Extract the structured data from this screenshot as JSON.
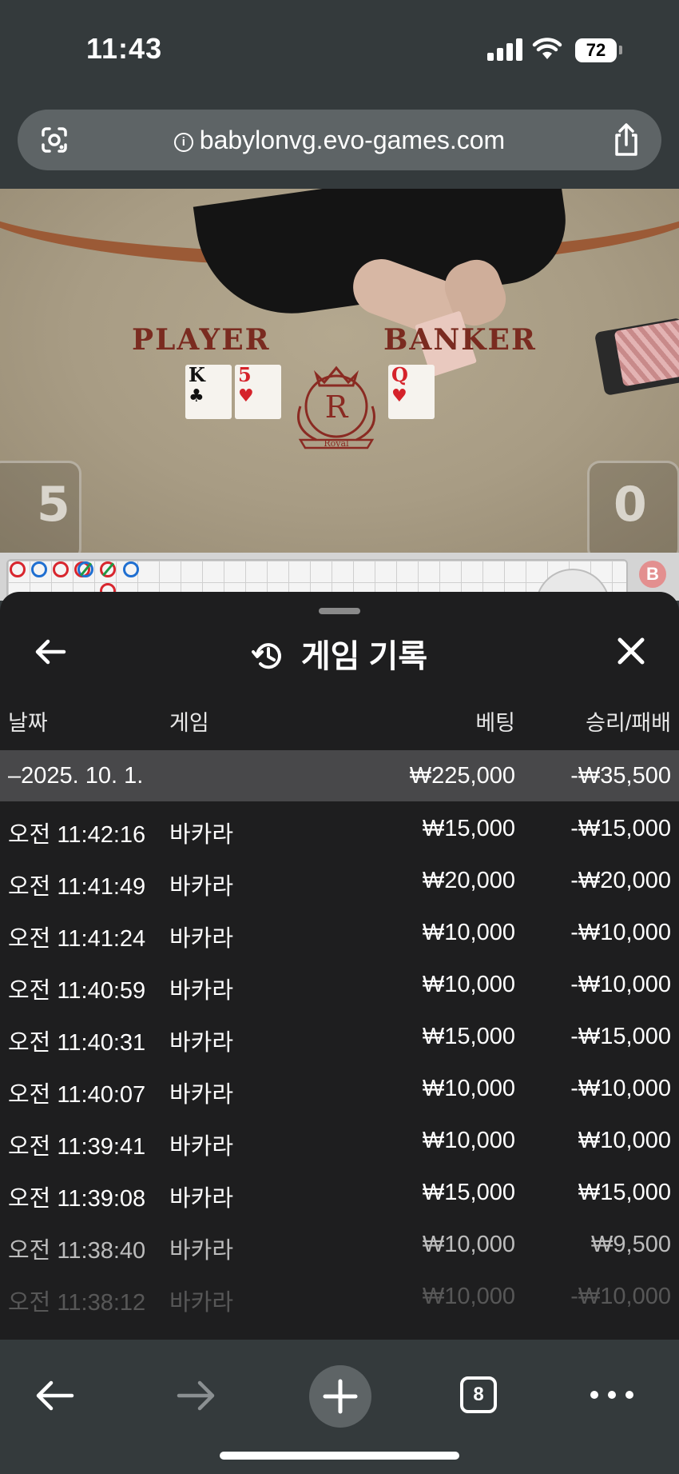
{
  "status_bar": {
    "time": "11:43",
    "battery": "72"
  },
  "browser": {
    "url": "babylonvg.evo-games.com"
  },
  "game_view": {
    "player_label": "PLAYER",
    "banker_label": "BANKER",
    "player_score": "5",
    "banker_score": "0",
    "player_cards": [
      {
        "rank": "K",
        "suit": "♣",
        "color": "black"
      },
      {
        "rank": "5",
        "suit": "♥",
        "color": "red"
      }
    ],
    "banker_cards": [
      {
        "rank": "Q",
        "suit": "♥",
        "color": "red"
      }
    ],
    "logo_letter": "R",
    "logo_text": "Royal",
    "road_badge": "B"
  },
  "sheet": {
    "title": "게임 기록",
    "columns": {
      "date": "날짜",
      "game": "게임",
      "bet": "베팅",
      "result": "승리/패배"
    },
    "summary": {
      "date": "–2025. 10. 1.",
      "bet": "₩225,000",
      "result": "-₩35,500"
    },
    "rows": [
      {
        "time": "오전 11:42:16",
        "game": "바카라",
        "bet": "₩15,000",
        "result": "-₩15,000"
      },
      {
        "time": "오전 11:41:49",
        "game": "바카라",
        "bet": "₩20,000",
        "result": "-₩20,000"
      },
      {
        "time": "오전 11:41:24",
        "game": "바카라",
        "bet": "₩10,000",
        "result": "-₩10,000"
      },
      {
        "time": "오전 11:40:59",
        "game": "바카라",
        "bet": "₩10,000",
        "result": "-₩10,000"
      },
      {
        "time": "오전 11:40:31",
        "game": "바카라",
        "bet": "₩15,000",
        "result": "-₩15,000"
      },
      {
        "time": "오전 11:40:07",
        "game": "바카라",
        "bet": "₩10,000",
        "result": "-₩10,000"
      },
      {
        "time": "오전 11:39:41",
        "game": "바카라",
        "bet": "₩10,000",
        "result": "₩10,000"
      },
      {
        "time": "오전 11:39:08",
        "game": "바카라",
        "bet": "₩15,000",
        "result": "₩15,000"
      },
      {
        "time": "오전 11:38:40",
        "game": "바카라",
        "bet": "₩10,000",
        "result": "₩9,500"
      },
      {
        "time": "오전 11:38:12",
        "game": "바카라",
        "bet": "₩10,000",
        "result": "-₩10,000"
      }
    ]
  },
  "toolbar": {
    "tab_count": "8"
  },
  "colors": {
    "sheet_bg": "#1e1e1f",
    "summary_bg": "#48484a",
    "chrome_bg": "#343a3c",
    "url_bar_bg": "#5e6466"
  }
}
